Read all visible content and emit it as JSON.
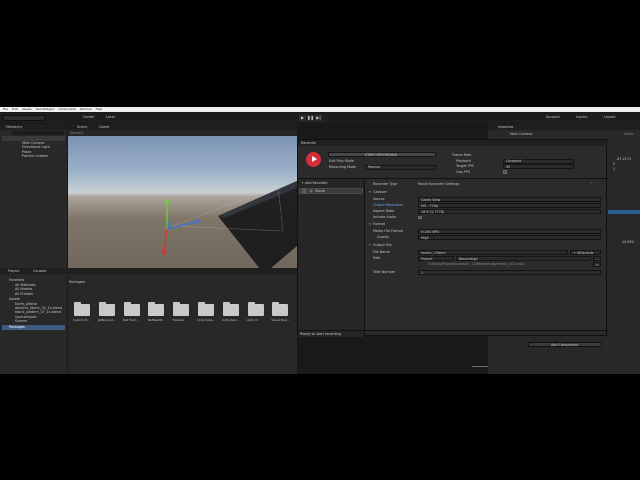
{
  "menubar": {
    "items": [
      "File",
      "Edit",
      "Assets",
      "GameObject",
      "Component",
      "Window",
      "Help"
    ]
  },
  "toolbar": {
    "center_label": "Center",
    "local_label": "Local",
    "account_label": "Account",
    "layers_label": "Layers",
    "layout_label": "Layout"
  },
  "hierarchy": {
    "tab_label": "Hierarchy",
    "items": [
      "Main Camera",
      "Directional Light",
      "Plane",
      "Particle System"
    ]
  },
  "scene": {
    "tab_scene": "Scene",
    "tab_game": "Game",
    "shaded": "Shaded",
    "gizmos": "Gizmos"
  },
  "project": {
    "tab_project": "Project",
    "tab_console": "Console",
    "favorites_label": "Favorites",
    "favorites": [
      "All Materials",
      "All Models",
      "All Prefabs"
    ],
    "assets_label": "Assets",
    "assets": [
      "Earth_Alfalsa",
      "dominic_fabric_02_1k.blend",
      "fabric_pattern_07_1k.blend",
      "inputsImport",
      "Scenes"
    ],
    "packages_label": "Packages",
    "breadcrumb": "Packages",
    "folders": [
      "Custom N...",
      "JetBrains R...",
      "Test Fram...",
      "TextMeshP...",
      "Timeline",
      "Unity Colla...",
      "Unity Reco...",
      "Unity UI",
      "Visual Stud...",
      "Visual Stud..."
    ]
  },
  "inspector": {
    "tab_label": "Inspector",
    "object_name": "Main Camera",
    "tag_label": "Static",
    "add_component": "Add Component",
    "right_values": [
      "-47.2172",
      "2",
      "1",
      "14.654"
    ]
  },
  "recorder": {
    "window_title": "Recorder",
    "start_button": "START RECORDING",
    "exit_play_mode": "Exit Play Mode",
    "recording_mode_label": "Recording Mode",
    "recording_mode_value": "Manual",
    "frame_rate_label": "Frame Rate",
    "playback_label": "Playback",
    "playback_value": "Constant",
    "target_fps_label": "Target FPS",
    "target_fps_value": "30",
    "cap_fps_label": "Cap FPS",
    "add_recorder": "+ Add Recorder",
    "recorder_item": "Movie",
    "recorder_type_label": "Recorder Type",
    "recorder_type_value": "Movie Recorder Settings",
    "capture_header": "Capture",
    "source_label": "Source",
    "source_value": "Game View",
    "output_res_label": "Output Resolution",
    "output_res_value": "HD - 720p",
    "aspect_label": "Aspect Ratio",
    "aspect_value": "16:9 (1.7778)",
    "include_audio_label": "Include Audio",
    "format_header": "Format",
    "media_format_label": "Media File Format",
    "media_format_value": "H.264 MP4",
    "quality_label": "Quality",
    "quality_value": "High",
    "output_file_header": "Output File",
    "file_name_label": "File Name",
    "file_name_value": "movie_<Take>",
    "wildcards": "+ Wildcards",
    "path_label": "Path",
    "path_root": "Project",
    "path_value": "Recordings",
    "full_path": "D:/UnityProjects/class/IO_11/Recordings/movie_001.mp4",
    "take_number_label": "Take Number",
    "take_number_value": "1",
    "status": "Ready to start recording"
  }
}
